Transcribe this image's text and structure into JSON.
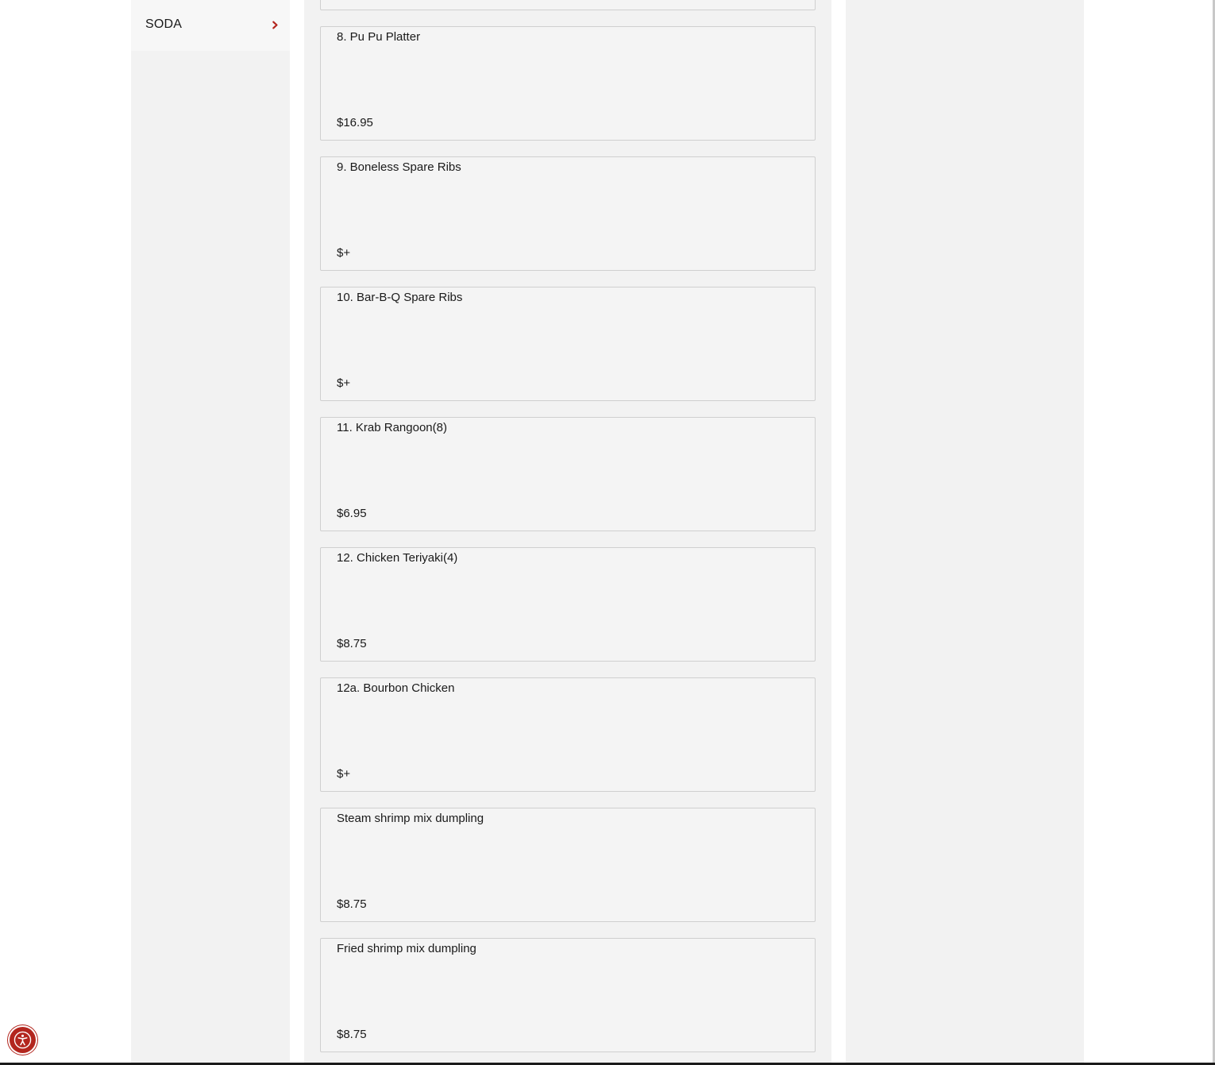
{
  "sidebar": {
    "categories": [
      {
        "label": "SODA"
      }
    ]
  },
  "menu": {
    "items": [
      {
        "name": "8. Pu Pu Platter",
        "price": "$16.95"
      },
      {
        "name": "9. Boneless Spare Ribs",
        "price": "$+"
      },
      {
        "name": "10. Bar-B-Q Spare Ribs",
        "price": "$+"
      },
      {
        "name": "11. Krab Rangoon(8)",
        "price": "$6.95"
      },
      {
        "name": "12. Chicken Teriyaki(4)",
        "price": "$8.75"
      },
      {
        "name": "12a. Bourbon Chicken",
        "price": "$+"
      },
      {
        "name": "Steam shrimp mix dumpling",
        "price": "$8.75"
      },
      {
        "name": "Fried shrimp mix dumpling",
        "price": "$8.75"
      }
    ]
  },
  "colors": {
    "accent": "#b3261e",
    "panel_background": "#f2f2f2",
    "card_background": "#f4f4f4",
    "card_border": "#cfcfcf"
  },
  "icons": {
    "category_chevron": "chevron-right-icon",
    "accessibility": "accessibility-icon"
  }
}
